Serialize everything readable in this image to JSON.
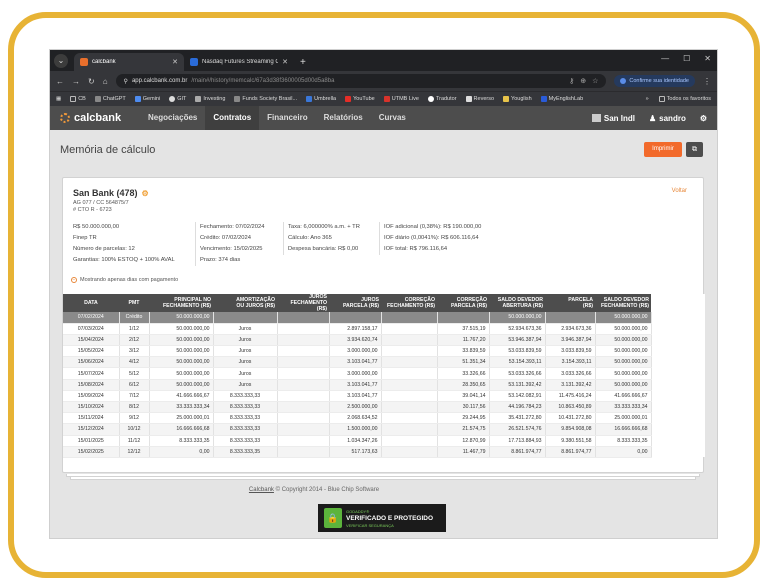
{
  "browser": {
    "tabs": [
      {
        "title": "calcbank",
        "active": true
      },
      {
        "title": "Nasdaq Futures Streaming Cha...",
        "active": false
      }
    ],
    "url": {
      "host": "app.calcbank.com.br",
      "path": "/main#/history/memcalc/67a3d38f3600005d00d5a8ba"
    },
    "identity_button": "Confirme sua identidade",
    "bookmarks": [
      "CB",
      "ChatGPT",
      "Gemini",
      "GIT",
      "Investing",
      "Funds Society Brasil...",
      "Umbrella",
      "YouTube",
      "UTMB Live",
      "Tradutor",
      "Reverso",
      "Youglish",
      "MyEnglishLab"
    ],
    "bookmarks_more": "»",
    "bookmarks_folder": "Todos os favoritos"
  },
  "app": {
    "logo": "calcbank",
    "nav": [
      "Negociações",
      "Contratos",
      "Financeiro",
      "Relatórios",
      "Curvas"
    ],
    "active_nav": "Contratos",
    "bank_user": "San Indl",
    "user": "sandro"
  },
  "page": {
    "title": "Memória de cálculo",
    "print_label": "Imprimir",
    "back_label": "Voltar"
  },
  "contract": {
    "name": "San Bank (478)",
    "sub1": "AG 077 / CC 564875/7",
    "sub2": "# CTO R - 6723",
    "col1": [
      "R$ 50.000.000,00",
      "Finep TR",
      "Número de parcelas: 12",
      "Garantias: 100% ESTOQ + 100% AVAL"
    ],
    "col2": [
      "Fechamento: 07/02/2024",
      "Crédito: 07/02/2024",
      "Vencimento: 15/02/2025",
      "Prazo: 374 dias"
    ],
    "col3": [
      "Taxa: 6,000000% a.m. + TR",
      "Cálculo: Ano 365",
      "Despesa bancária: R$ 0,00"
    ],
    "col4": [
      "IOF adicional (0,38%): R$ 190.000,00",
      "IOF diário (0,0041%): R$ 606.116,64",
      "IOF total: R$ 796.116,64"
    ],
    "toggle_label": "Mostrando apenas dias com pagamento"
  },
  "table": {
    "headers": [
      "DATA",
      "PMT",
      "PRINCIPAL NO\nFECHAMENTO (R$)",
      "AMORTIZAÇÃO\nOU JUROS (R$)",
      "JUROS\nFECHAMENTO (R$)",
      "JUROS\nPARCELA (R$)",
      "CORREÇÃO\nFECHAMENTO (R$)",
      "CORREÇÃO\nPARCELA (R$)",
      "SALDO DEVEDOR\nABERTURA (R$)",
      "PARCELA\n(R$)",
      "SALDO DEVEDOR\nFECHAMENTO (R$)"
    ],
    "rows": [
      [
        "07/02/2024",
        "Crédito",
        "50.000.000,00",
        "",
        "",
        "",
        "",
        "",
        "50.000.000,00",
        "",
        "50.000.000,00"
      ],
      [
        "07/03/2024",
        "1/12",
        "50.000.000,00",
        "Juros",
        "",
        "2.897.158,17",
        "",
        "37.515,19",
        "52.934.673,36",
        "2.934.673,36",
        "50.000.000,00"
      ],
      [
        "15/04/2024",
        "2/12",
        "50.000.000,00",
        "Juros",
        "",
        "3.934.620,74",
        "",
        "11.767,20",
        "53.946.387,94",
        "3.946.387,94",
        "50.000.000,00"
      ],
      [
        "15/05/2024",
        "3/12",
        "50.000.000,00",
        "Juros",
        "",
        "3.000.000,00",
        "",
        "33.839,59",
        "53.033.839,59",
        "3.033.839,59",
        "50.000.000,00"
      ],
      [
        "15/06/2024",
        "4/12",
        "50.000.000,00",
        "Juros",
        "",
        "3.103.041,77",
        "",
        "51.351,34",
        "53.154.393,11",
        "3.154.393,11",
        "50.000.000,00"
      ],
      [
        "15/07/2024",
        "5/12",
        "50.000.000,00",
        "Juros",
        "",
        "3.000.000,00",
        "",
        "33.326,66",
        "53.033.326,66",
        "3.033.326,66",
        "50.000.000,00"
      ],
      [
        "15/08/2024",
        "6/12",
        "50.000.000,00",
        "Juros",
        "",
        "3.103.041,77",
        "",
        "28.350,65",
        "53.131.392,42",
        "3.131.392,42",
        "50.000.000,00"
      ],
      [
        "15/09/2024",
        "7/12",
        "41.666.666,67",
        "8.333.333,33",
        "",
        "3.103.041,77",
        "",
        "39.041,14",
        "53.142.082,91",
        "11.475.416,24",
        "41.666.666,67"
      ],
      [
        "15/10/2024",
        "8/12",
        "33.333.333,34",
        "8.333.333,33",
        "",
        "2.500.000,00",
        "",
        "30.117,56",
        "44.196.784,23",
        "10.863.450,89",
        "33.333.333,34"
      ],
      [
        "15/11/2024",
        "9/12",
        "25.000.000,01",
        "8.333.333,33",
        "",
        "2.068.634,52",
        "",
        "29.244,95",
        "35.431.272,80",
        "10.431.272,80",
        "25.000.000,01"
      ],
      [
        "15/12/2024",
        "10/12",
        "16.666.666,68",
        "8.333.333,33",
        "",
        "1.500.000,00",
        "",
        "21.574,75",
        "26.521.574,76",
        "9.854.908,08",
        "16.666.666,68"
      ],
      [
        "15/01/2025",
        "11/12",
        "8.333.333,35",
        "8.333.333,33",
        "",
        "1.034.347,26",
        "",
        "12.870,99",
        "17.713.884,93",
        "9.380.551,58",
        "8.333.333,35"
      ],
      [
        "15/02/2025",
        "12/12",
        "0,00",
        "8.333.333,35",
        "",
        "517.173,63",
        "",
        "11.467,79",
        "8.861.974,77",
        "8.861.974,77",
        "0,00"
      ]
    ]
  },
  "footer": {
    "link": "Calcbank",
    "text": " © Copyright 2014 - Blue Chip Software",
    "seal_brand": "GODADDY®",
    "seal_title": "VERIFICADO E PROTEGIDO",
    "seal_sub": "VERIFICAR SEGURANÇA"
  }
}
